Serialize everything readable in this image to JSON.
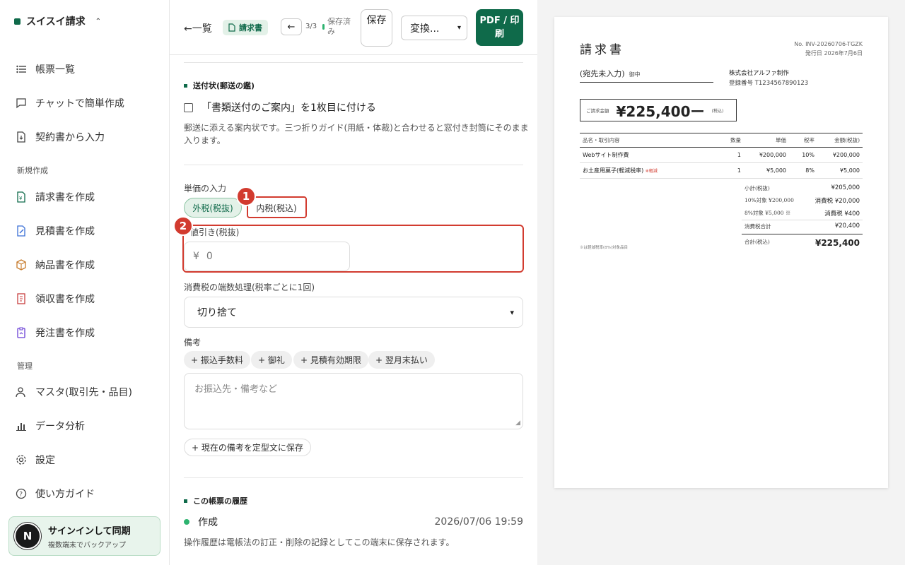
{
  "app": {
    "name": "スイスイ請求"
  },
  "sidebar": {
    "items": [
      {
        "label": "帳票一覧",
        "icon": "list-icon"
      },
      {
        "label": "チャットで簡単作成",
        "icon": "chat-icon"
      },
      {
        "label": "契約書から入力",
        "icon": "file-import-icon"
      }
    ],
    "section_new": "新規作成",
    "new_items": [
      {
        "label": "請求書を作成",
        "icon": "invoice-icon"
      },
      {
        "label": "見積書を作成",
        "icon": "quote-icon"
      },
      {
        "label": "納品書を作成",
        "icon": "box-icon"
      },
      {
        "label": "領収書を作成",
        "icon": "receipt-icon"
      },
      {
        "label": "発注書を作成",
        "icon": "order-icon"
      }
    ],
    "section_manage": "管理",
    "manage_items": [
      {
        "label": "マスタ(取引先・品目)",
        "icon": "user-icon"
      },
      {
        "label": "データ分析",
        "icon": "chart-icon"
      },
      {
        "label": "設定",
        "icon": "gear-icon"
      },
      {
        "label": "使い方ガイド",
        "icon": "help-icon"
      }
    ],
    "signin": {
      "avatar": "N",
      "title": "サインインして同期",
      "subtitle": "複数端末でバックアップ"
    }
  },
  "toolbar": {
    "back": "←一覧",
    "doc_type": "請求書",
    "prev": "←",
    "pager": "3/3",
    "save_status": "保存済み",
    "save": "保存",
    "convert": "変換...",
    "pdf": "PDF / 印刷"
  },
  "form": {
    "cover_section": "送付状(郵送の鑑)",
    "cover_checkbox": "「書類送付のご案内」を1枚目に付ける",
    "cover_help": "郵送に添える案内状です。三つ折りガイド(用紙・体裁)と合わせると窓付き封筒にそのまま入ります。",
    "price_label": "単価の入力",
    "tax_excluded": "外税(税抜)",
    "tax_included": "内税(税込)",
    "discount_label": "値引き(税抜)",
    "discount_value": "0",
    "currency": "¥",
    "rounding_label": "消費税の端数処理(税率ごとに1回)",
    "rounding_value": "切り捨て",
    "notes_label": "備考",
    "note_chips": [
      "+ 振込手数料",
      "+ 御礼",
      "+ 見積有効期限",
      "+ 翌月末払い"
    ],
    "notes_placeholder": "お振込先・備考など",
    "save_template": "+ 現在の備考を定型文に保存",
    "history_section": "この帳票の履歴",
    "history": [
      {
        "action": "作成",
        "date": "2026/07/06 19:59"
      }
    ],
    "history_note": "操作履歴は電帳法の訂正・削除の記録としてこの端末に保存されます。"
  },
  "annotations": {
    "badge1": "1",
    "badge2": "2"
  },
  "preview": {
    "title": "請求書",
    "number": "No. INV-20260706-TGZK",
    "issued": "発行日 2026年7月6日",
    "recipient": "(宛先未入力)",
    "honorific": "御中",
    "issuer": "株式会社アルファ制作",
    "registration": "登録番号 T1234567890123",
    "amount_label": "ご請求金額",
    "amount": "¥225,400ー",
    "amount_tax": "(税込)",
    "columns": [
      "品名・取引内容",
      "数量",
      "単価",
      "税率",
      "金額(税抜)"
    ],
    "rows": [
      {
        "name": "Webサイト制作費",
        "mark": "",
        "qty": "1",
        "price": "¥200,000",
        "rate": "10%",
        "amount": "¥200,000"
      },
      {
        "name": "お土産用菓子(軽減税率)",
        "mark": "※軽減",
        "qty": "1",
        "price": "¥5,000",
        "rate": "8%",
        "amount": "¥5,000"
      }
    ],
    "summary": [
      {
        "label": "小計(税抜)",
        "value": "¥205,000"
      },
      {
        "label": "10%対象 ¥200,000",
        "value": "消費税 ¥20,000"
      },
      {
        "label": "8%対象 ¥5,000 ※",
        "value": "消費税 ¥400"
      },
      {
        "label": "消費税合計",
        "value": "¥20,400"
      }
    ],
    "total_label": "合計(税込)",
    "total": "¥225,400",
    "footnote": "※は軽減税率(8%)対象品目"
  },
  "colors": {
    "brand": "#0f6a4a",
    "annotation": "#d23b2f",
    "accent_light": "#e3f1e8"
  }
}
